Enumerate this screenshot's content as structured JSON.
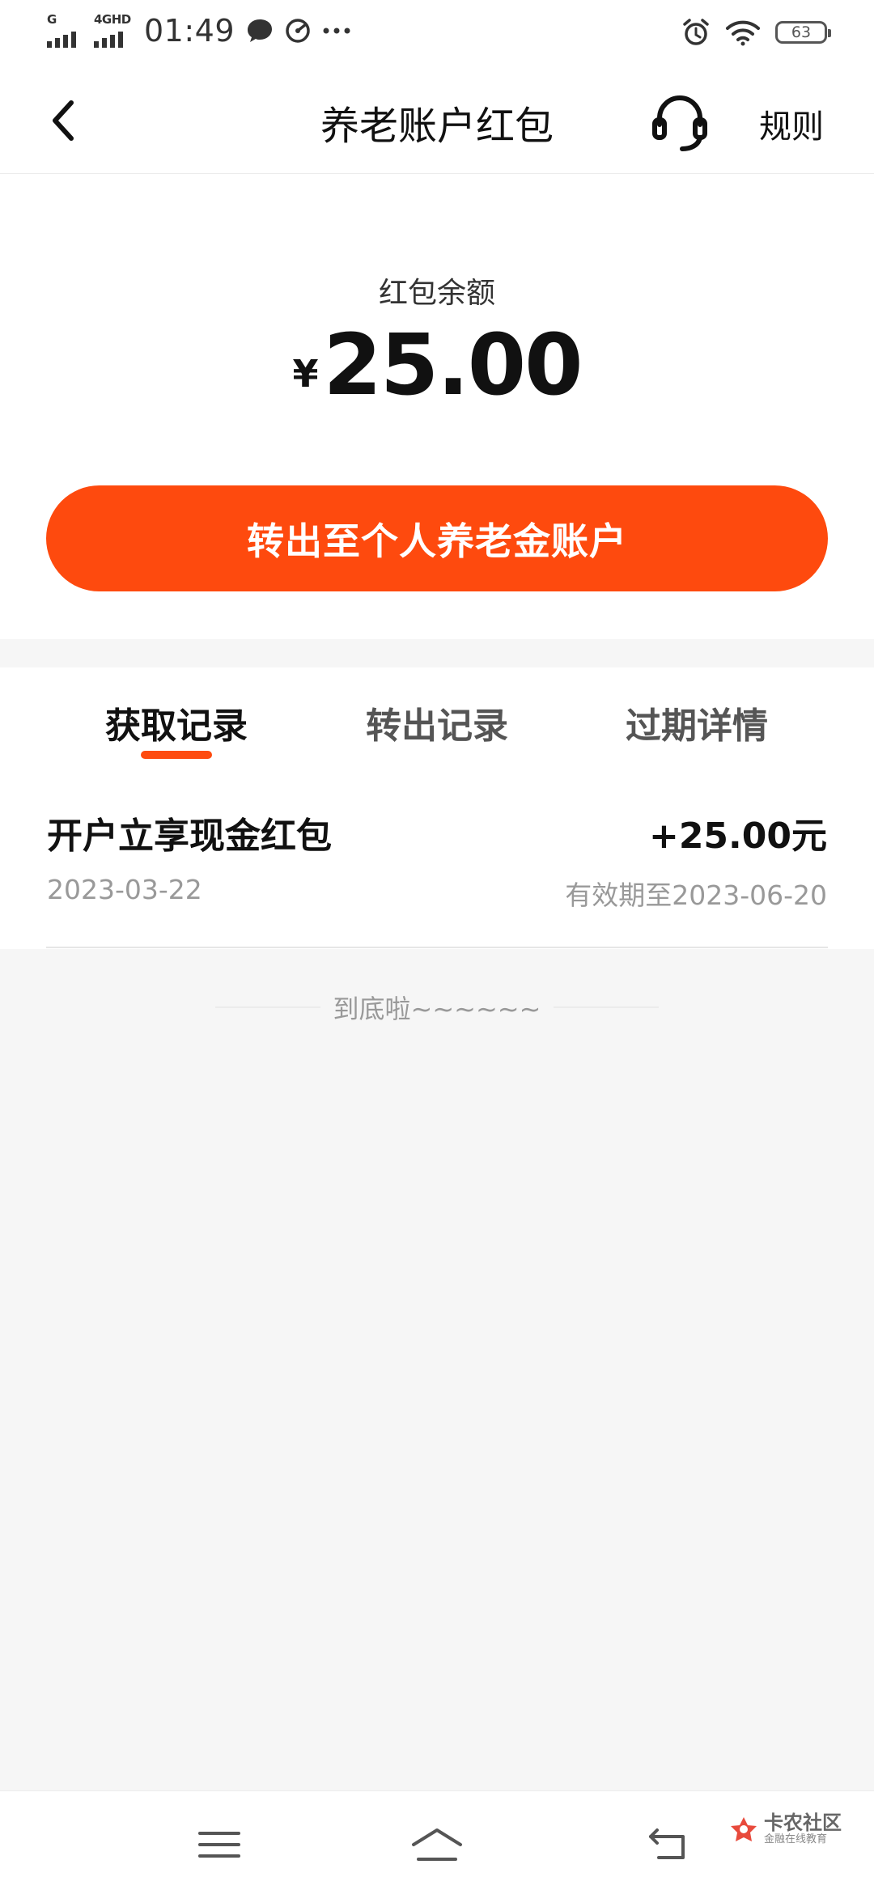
{
  "status_bar": {
    "network_1": "G",
    "network_2": "4GHD",
    "time": "01:49",
    "battery": "63",
    "icons": [
      "chat-bubble-icon",
      "speed-gauge-icon",
      "more-dots-icon",
      "alarm-clock-icon",
      "wifi-icon",
      "battery-icon"
    ]
  },
  "header": {
    "title": "养老账户红包",
    "rules_label": "规则",
    "icons": [
      "back-chevron-icon",
      "headset-icon"
    ]
  },
  "balance": {
    "label": "红包余额",
    "currency": "¥",
    "amount": "25.00"
  },
  "transfer_button": {
    "label": "转出至个人养老金账户"
  },
  "tabs": [
    {
      "label": "获取记录",
      "active": true
    },
    {
      "label": "转出记录",
      "active": false
    },
    {
      "label": "过期详情",
      "active": false
    }
  ],
  "records": [
    {
      "title": "开户立享现金红包",
      "amount": "+25.00元",
      "date": "2023-03-22",
      "expiry": "有效期至2023-06-20"
    }
  ],
  "end_text": "到底啦~~~~~~",
  "nav_bar": {
    "icons": [
      "menu-icon",
      "home-icon",
      "back-icon"
    ]
  },
  "watermark": {
    "title": "卡农社区",
    "subtitle": "金融在线教育"
  },
  "colors": {
    "accent": "#fe4a0e",
    "background": "#f6f6f6"
  }
}
